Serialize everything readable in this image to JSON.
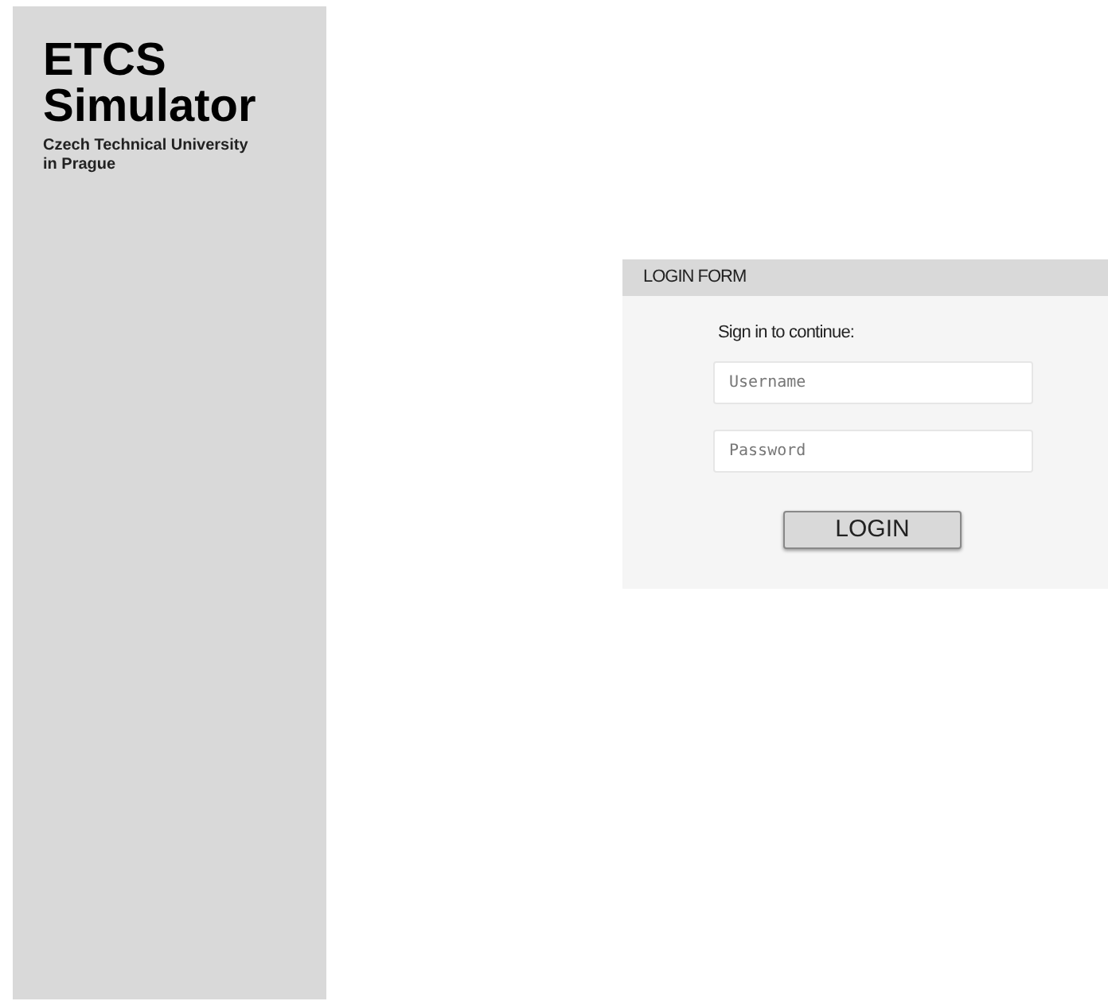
{
  "sidebar": {
    "title_line_1": "ETCS",
    "title_line_2": "Simulator",
    "subtitle": "Czech Technical University in Prague"
  },
  "login_form": {
    "header": "LOGIN FORM",
    "prompt": "Sign in to continue:",
    "fields": [
      {
        "placeholder": "Username"
      },
      {
        "placeholder": "Password"
      }
    ],
    "button": "LOGIN"
  }
}
